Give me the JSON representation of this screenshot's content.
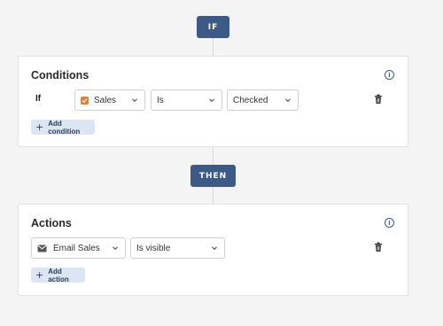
{
  "flow": {
    "if_label": "IF",
    "then_label": "THEN"
  },
  "conditions": {
    "title": "Conditions",
    "row_label": "If",
    "field": {
      "value": "Sales",
      "icon": "checkbox-icon",
      "icon_color": "#ea7d2e"
    },
    "operator": {
      "value": "Is"
    },
    "value": {
      "value": "Checked"
    },
    "add_label": "Add condition"
  },
  "actions": {
    "title": "Actions",
    "field": {
      "value": "Email Sales",
      "icon": "email-icon"
    },
    "action": {
      "value": "Is visible"
    },
    "add_label": "Add action"
  },
  "colors": {
    "accent": "#3d5a87",
    "button_bg": "#dce6f3",
    "page_bg": "#f4f4f4"
  }
}
